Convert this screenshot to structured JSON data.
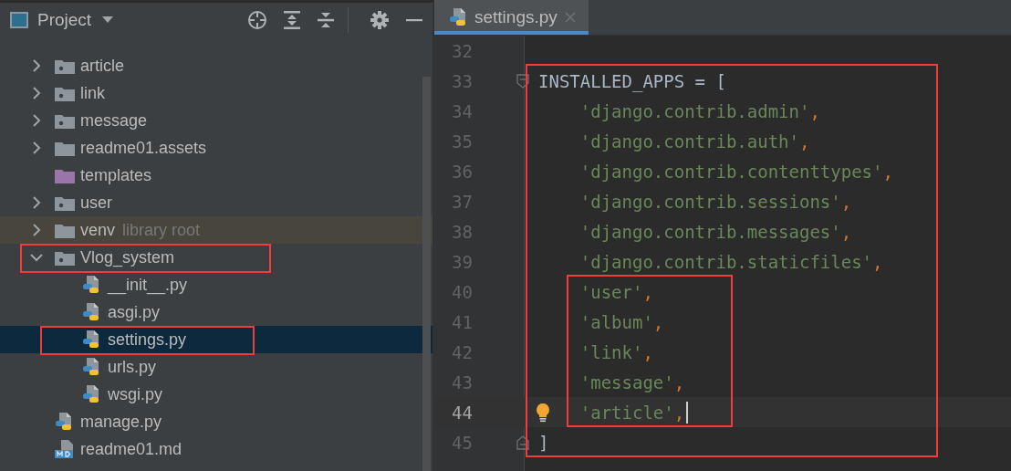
{
  "project_panel": {
    "title": "Project",
    "tree": [
      {
        "label": "article",
        "kind": "module",
        "expanded": false,
        "selected": false
      },
      {
        "label": "link",
        "kind": "module",
        "expanded": false,
        "selected": false
      },
      {
        "label": "message",
        "kind": "module",
        "expanded": false,
        "selected": false
      },
      {
        "label": "readme01.assets",
        "kind": "folder",
        "expanded": false,
        "selected": false
      },
      {
        "label": "templates",
        "kind": "resource",
        "selected": false
      },
      {
        "label": "user",
        "kind": "module",
        "expanded": false,
        "selected": false
      },
      {
        "label": "venv",
        "hint": "library root",
        "kind": "folder",
        "library": true,
        "expanded": false,
        "selected": false
      },
      {
        "label": "Vlog_system",
        "kind": "module",
        "expanded": true,
        "selected": false,
        "boxed": true,
        "children": [
          {
            "label": "__init__.py",
            "kind": "python",
            "selected": false
          },
          {
            "label": "asgi.py",
            "kind": "python",
            "selected": false
          },
          {
            "label": "settings.py",
            "kind": "python",
            "selected": true,
            "boxed": true
          },
          {
            "label": "urls.py",
            "kind": "python",
            "selected": false
          },
          {
            "label": "wsgi.py",
            "kind": "python",
            "selected": false
          }
        ]
      },
      {
        "label": "manage.py",
        "kind": "python",
        "selected": false
      },
      {
        "label": "readme01.md",
        "kind": "markdown",
        "selected": false
      }
    ]
  },
  "editor": {
    "tabs": [
      {
        "label": "settings.py",
        "selected": true
      }
    ],
    "lines": [
      {
        "number": "32"
      },
      {
        "number": "33",
        "fold_start": true,
        "outer_box": true,
        "tokens": [
          {
            "kind": "name",
            "text": "INSTALLED_APPS"
          },
          {
            "kind": "operator",
            "text": " = ["
          }
        ]
      },
      {
        "number": "34",
        "outer_box": true,
        "tokens": [
          {
            "kind": "string",
            "text": "    'django.contrib.admin'"
          },
          {
            "kind": "comma",
            "text": ","
          }
        ]
      },
      {
        "number": "35",
        "outer_box": true,
        "tokens": [
          {
            "kind": "string",
            "text": "    'django.contrib.auth'"
          },
          {
            "kind": "comma",
            "text": ","
          }
        ]
      },
      {
        "number": "36",
        "outer_box": true,
        "tokens": [
          {
            "kind": "string",
            "text": "    'django.contrib.contenttypes'"
          },
          {
            "kind": "comma",
            "text": ","
          }
        ]
      },
      {
        "number": "37",
        "outer_box": true,
        "tokens": [
          {
            "kind": "string",
            "text": "    'django.contrib.sessions'"
          },
          {
            "kind": "comma",
            "text": ","
          }
        ]
      },
      {
        "number": "38",
        "outer_box": true,
        "tokens": [
          {
            "kind": "string",
            "text": "    'django.contrib.messages'"
          },
          {
            "kind": "comma",
            "text": ","
          }
        ]
      },
      {
        "number": "39",
        "outer_box": true,
        "tokens": [
          {
            "kind": "string",
            "text": "    'django.contrib.staticfiles'"
          },
          {
            "kind": "comma",
            "text": ","
          }
        ]
      },
      {
        "number": "40",
        "outer_box": true,
        "inner_box": true,
        "tokens": [
          {
            "kind": "string",
            "text": "    'user'"
          },
          {
            "kind": "comma",
            "text": ","
          }
        ]
      },
      {
        "number": "41",
        "outer_box": true,
        "inner_box": true,
        "tokens": [
          {
            "kind": "string",
            "text": "    'album'"
          },
          {
            "kind": "comma",
            "text": ","
          }
        ]
      },
      {
        "number": "42",
        "outer_box": true,
        "inner_box": true,
        "tokens": [
          {
            "kind": "string",
            "text": "    'link'"
          },
          {
            "kind": "comma",
            "text": ","
          }
        ]
      },
      {
        "number": "43",
        "outer_box": true,
        "inner_box": true,
        "tokens": [
          {
            "kind": "string",
            "text": "    'message'"
          },
          {
            "kind": "comma",
            "text": ","
          }
        ]
      },
      {
        "number": "44",
        "current": true,
        "bulb": true,
        "caret": true,
        "outer_box": true,
        "inner_box": true,
        "tokens": [
          {
            "kind": "string",
            "text": "    'article'"
          },
          {
            "kind": "comma",
            "text": ","
          }
        ]
      },
      {
        "number": "45",
        "fold_end": true,
        "outer_box": true,
        "tokens": [
          {
            "kind": "operator",
            "text": "]"
          }
        ]
      }
    ]
  }
}
